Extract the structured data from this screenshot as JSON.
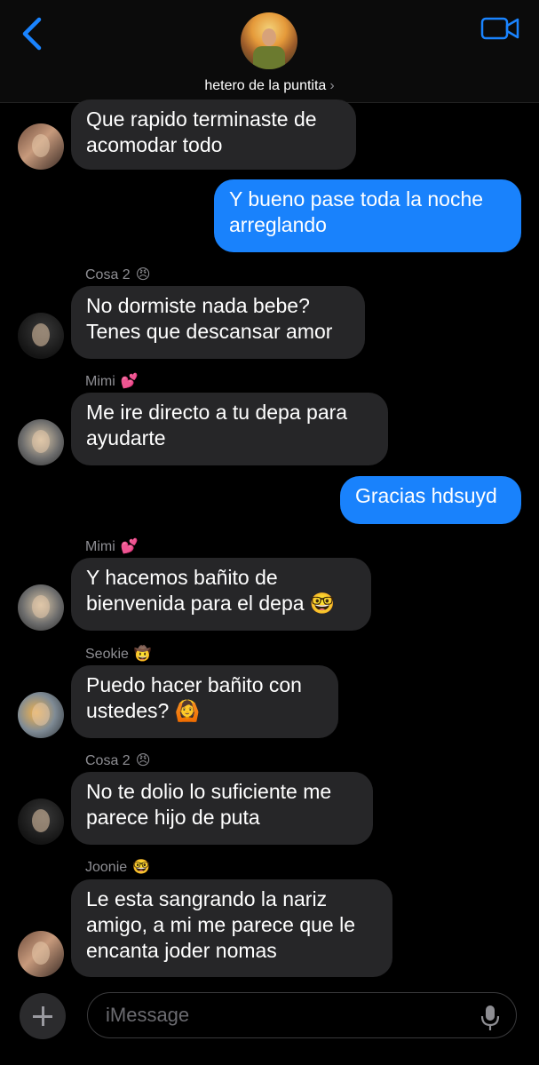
{
  "header": {
    "contact_name": "hetero de la puntita",
    "chevron": "›",
    "back_icon": "chevron-left-icon",
    "video_icon": "video-camera-icon",
    "accent": "#1a84ff"
  },
  "messages": [
    {
      "type": "in",
      "sender": "",
      "emoji": "",
      "lines": [
        "Que rapido terminaste de",
        "acomodar todo"
      ]
    },
    {
      "type": "out",
      "lines": [
        "Y bueno pase toda la noche",
        "arreglando"
      ]
    },
    {
      "type": "in",
      "sender": "Cosa 2",
      "emoji": "😠",
      "lines": [
        "No dormiste nada bebe?",
        "Tenes que descansar amor"
      ]
    },
    {
      "type": "in",
      "sender": "Mimi",
      "emoji": "💕",
      "lines": [
        "Me ire directo a tu depa para",
        "ayudarte"
      ]
    },
    {
      "type": "out",
      "lines": [
        "Gracias hdsuyd"
      ]
    },
    {
      "type": "in",
      "sender": "Mimi",
      "emoji": "💕",
      "lines": [
        "Y hacemos bañito de",
        "bienvenida para el depa 🤓"
      ]
    },
    {
      "type": "in",
      "sender": "Seokie",
      "emoji": "🤠",
      "lines": [
        "Puedo hacer bañito con",
        "ustedes? 🙆"
      ]
    },
    {
      "type": "in",
      "sender": "Cosa 2",
      "emoji": "😠",
      "lines": [
        "No te dolio lo suficiente me",
        "parece hijo de puta"
      ]
    },
    {
      "type": "in",
      "sender": "Joonie",
      "emoji": "🤓",
      "lines": [
        "Le esta sangrando la nariz",
        "amigo, a mi me parece que le",
        "encanta joder nomas"
      ]
    }
  ],
  "composer": {
    "placeholder": "iMessage",
    "plus_icon": "plus-icon",
    "mic_icon": "microphone-icon"
  },
  "colors": {
    "incoming_bubble": "#262628",
    "outgoing_bubble": "#1982fc",
    "background": "#000000"
  }
}
